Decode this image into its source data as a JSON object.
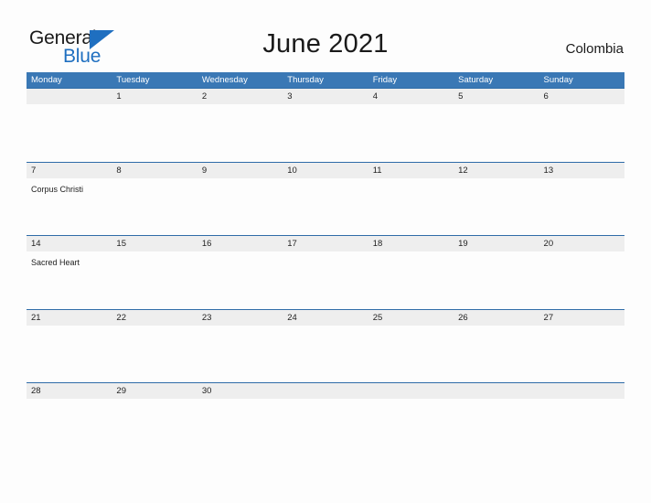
{
  "brand": {
    "word_one": "General",
    "word_two": "Blue",
    "flag_icon": "flag-triangle-icon",
    "accent_color": "#1f6fc0"
  },
  "header": {
    "title": "June 2021",
    "country": "Colombia"
  },
  "theme": {
    "header_blue": "#3a78b5",
    "rule_blue": "#2f6ca8",
    "band_gray": "#eeeeee",
    "page_background": "#fdfdfd",
    "text_color": "#222222"
  },
  "calendar": {
    "month": "June",
    "year": "2021",
    "weekday_headers": [
      "Monday",
      "Tuesday",
      "Wednesday",
      "Thursday",
      "Friday",
      "Saturday",
      "Sunday"
    ],
    "weeks": [
      {
        "days": [
          {
            "num": "",
            "events": []
          },
          {
            "num": "1",
            "events": []
          },
          {
            "num": "2",
            "events": []
          },
          {
            "num": "3",
            "events": []
          },
          {
            "num": "4",
            "events": []
          },
          {
            "num": "5",
            "events": []
          },
          {
            "num": "6",
            "events": []
          }
        ]
      },
      {
        "days": [
          {
            "num": "7",
            "events": [
              "Corpus Christi"
            ]
          },
          {
            "num": "8",
            "events": []
          },
          {
            "num": "9",
            "events": []
          },
          {
            "num": "10",
            "events": []
          },
          {
            "num": "11",
            "events": []
          },
          {
            "num": "12",
            "events": []
          },
          {
            "num": "13",
            "events": []
          }
        ]
      },
      {
        "days": [
          {
            "num": "14",
            "events": [
              "Sacred Heart"
            ]
          },
          {
            "num": "15",
            "events": []
          },
          {
            "num": "16",
            "events": []
          },
          {
            "num": "17",
            "events": []
          },
          {
            "num": "18",
            "events": []
          },
          {
            "num": "19",
            "events": []
          },
          {
            "num": "20",
            "events": []
          }
        ]
      },
      {
        "days": [
          {
            "num": "21",
            "events": []
          },
          {
            "num": "22",
            "events": []
          },
          {
            "num": "23",
            "events": []
          },
          {
            "num": "24",
            "events": []
          },
          {
            "num": "25",
            "events": []
          },
          {
            "num": "26",
            "events": []
          },
          {
            "num": "27",
            "events": []
          }
        ]
      },
      {
        "days": [
          {
            "num": "28",
            "events": []
          },
          {
            "num": "29",
            "events": []
          },
          {
            "num": "30",
            "events": []
          },
          {
            "num": "",
            "events": []
          },
          {
            "num": "",
            "events": []
          },
          {
            "num": "",
            "events": []
          },
          {
            "num": "",
            "events": []
          }
        ]
      }
    ]
  }
}
